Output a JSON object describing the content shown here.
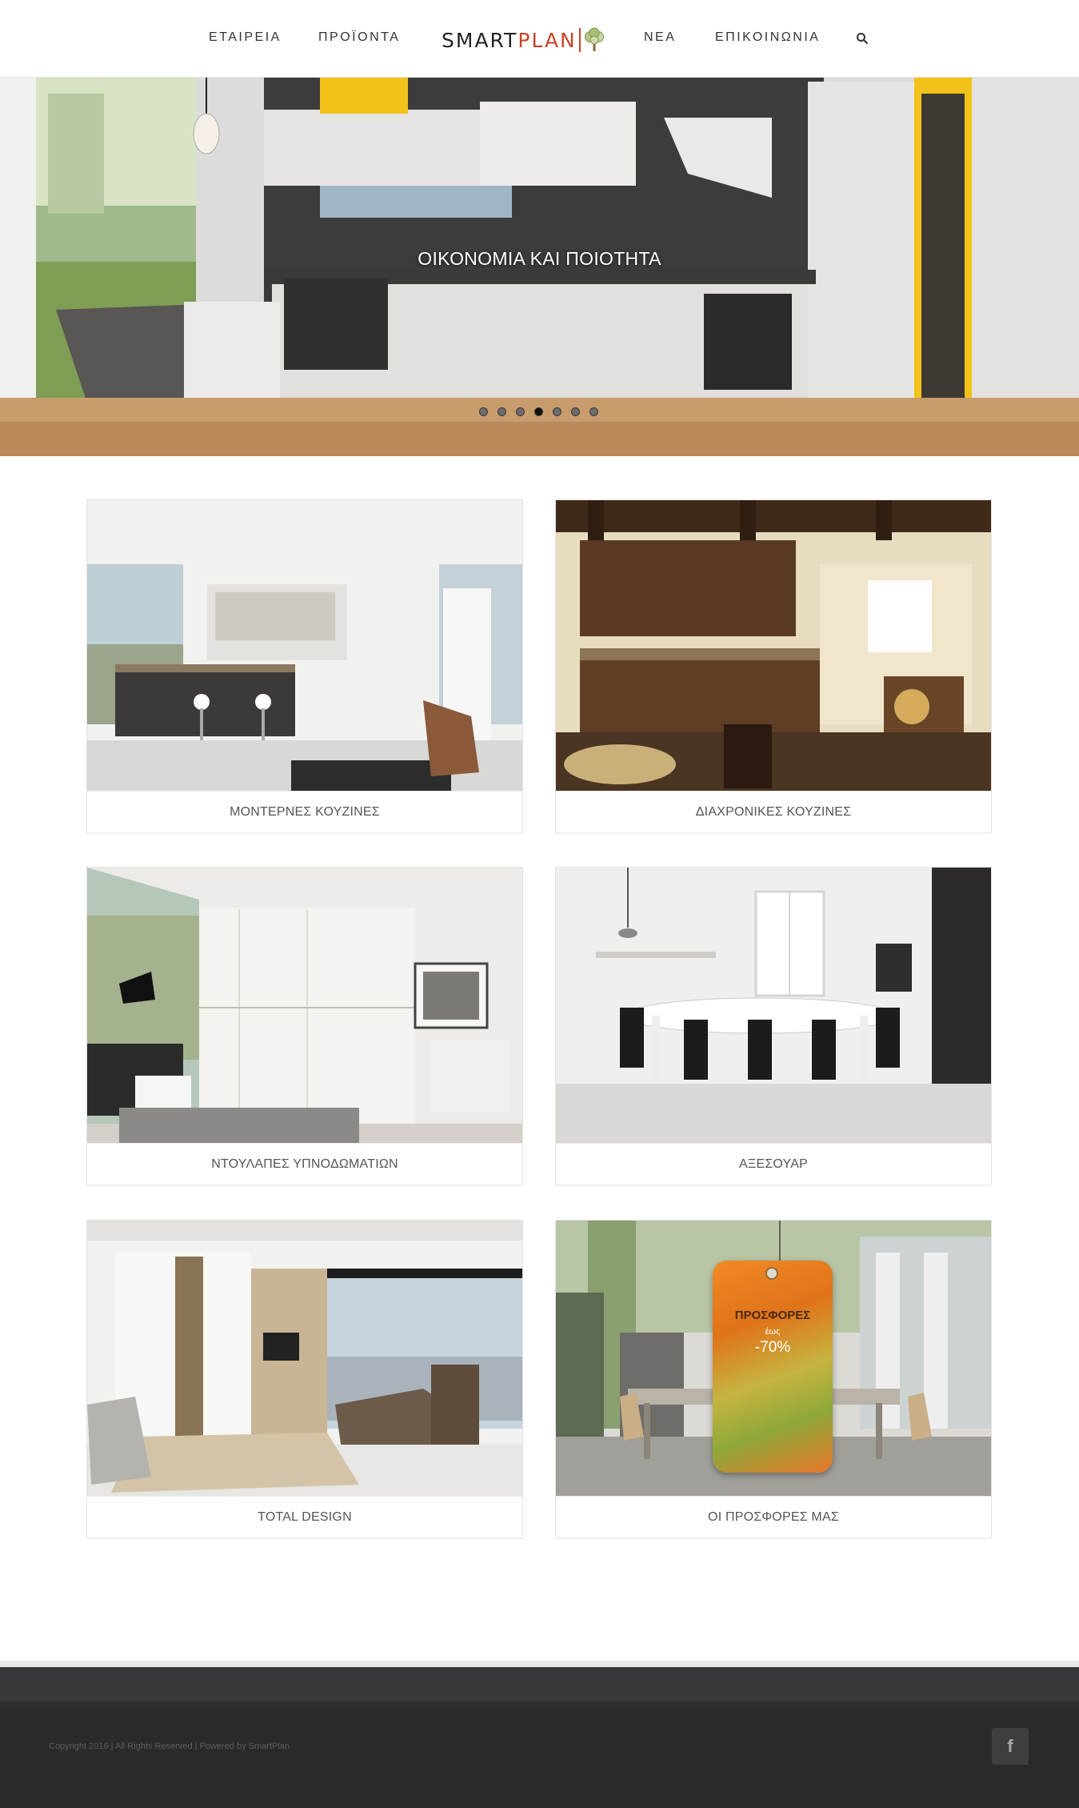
{
  "nav": {
    "left": [
      "ΕΤΑΙΡΕΙΑ",
      "ΠΡΟΪΟΝΤΑ"
    ],
    "right": [
      "ΝΕΑ",
      "ΕΠΙΚΟΙΝΩΝΙΑ"
    ]
  },
  "logo": {
    "part1": "SMART",
    "part2": "PLAN"
  },
  "hero": {
    "caption": "ΟΙΚΟΝΟΜΙΑ ΚΑΙ ΠΟΙΟΤΗΤΑ",
    "slide_count": 7,
    "active_slide": 4
  },
  "cards": [
    {
      "label": "ΜΟΝΤΕΡΝΕΣ ΚΟΥΖΙΝΕΣ"
    },
    {
      "label": "ΔΙΑΧΡΟΝΙΚΕΣ ΚΟΥΖΙΝΕΣ"
    },
    {
      "label": "ΝΤΟΥΛΑΠΕΣ ΥΠΝΟΔΩΜΑΤΙΩΝ"
    },
    {
      "label": "ΑΞΕΣΟΥΑΡ"
    },
    {
      "label": "TOTAL DESIGN"
    },
    {
      "label": "ΟΙ ΠΡΟΣΦΟΡΕΣ ΜΑΣ"
    }
  ],
  "offer_tag": {
    "title": "ΠΡΟΣΦΟΡΕΣ",
    "subtitle": "έως",
    "discount": "-70%"
  },
  "footer": {
    "copyright": "Copyright 2016 |   All Rights Reserved   |   Powered by SmartPlan",
    "social_icon": "facebook-icon"
  },
  "colors": {
    "brand_red": "#c9432b",
    "footer_bg": "#282a2b",
    "accent_yellow": "#f2c21a"
  }
}
